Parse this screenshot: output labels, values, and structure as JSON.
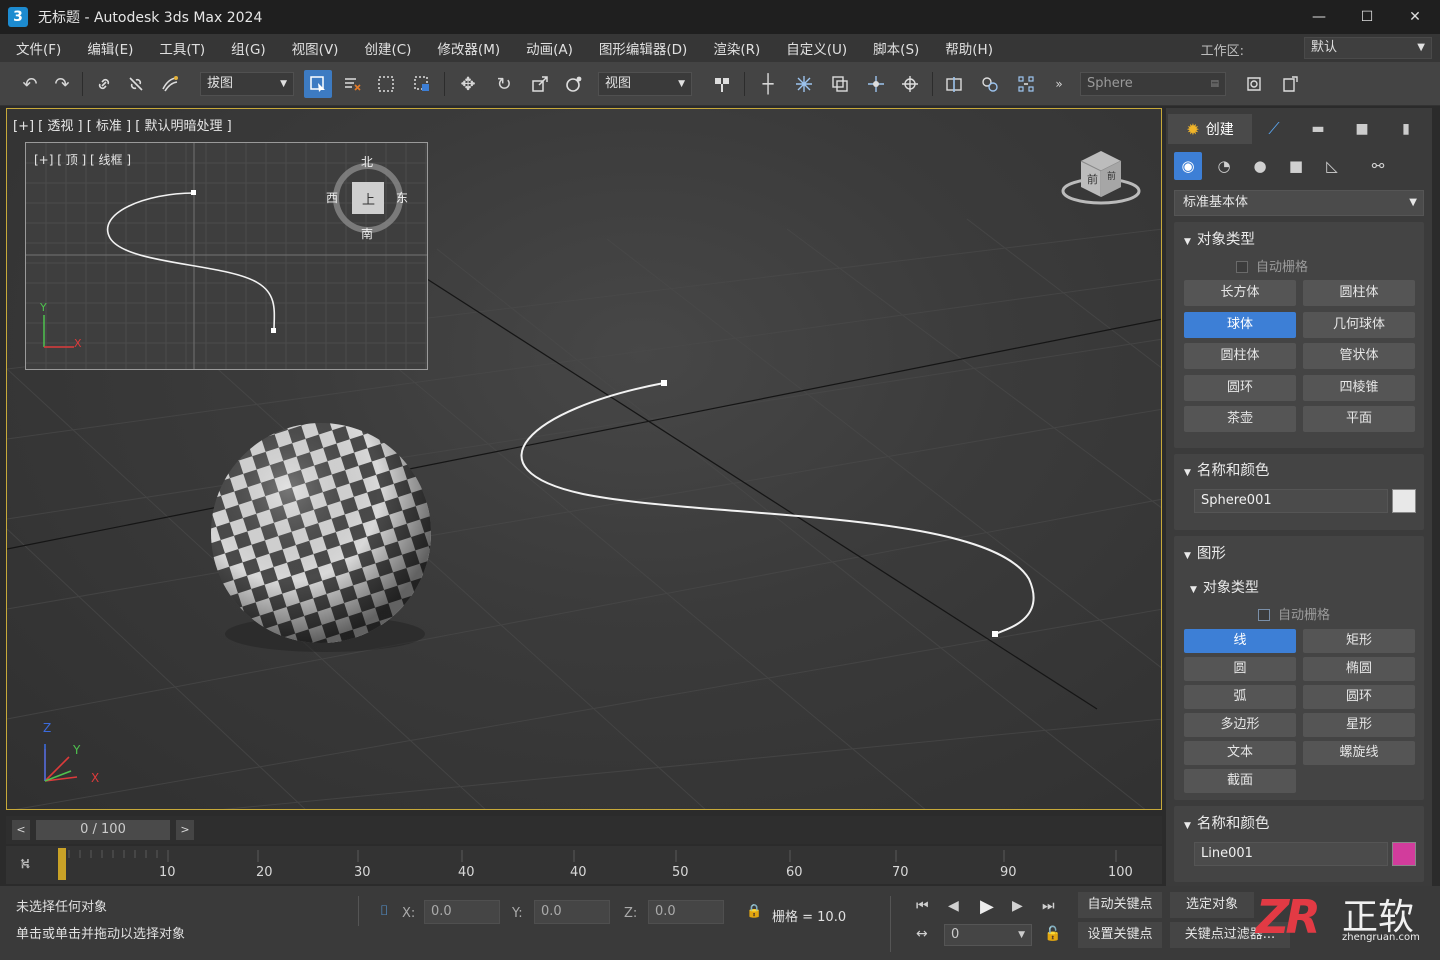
{
  "window": {
    "app_icon": "3",
    "title": "无标题 - Autodesk 3ds Max 2024",
    "minimize": "—",
    "maximize": "☐",
    "close": "✕"
  },
  "menu": [
    "文件(F)",
    "编辑(E)",
    "工具(T)",
    "组(G)",
    "视图(V)",
    "创建(C)",
    "修改器(M)",
    "动画(A)",
    "图形编辑器(D)",
    "渲染(R)",
    "自定义(U)",
    "脚本(S)",
    "帮助(H)"
  ],
  "workspace": {
    "label": "工作区:",
    "value": "默认"
  },
  "toolbar": {
    "selection_filter": "拔图",
    "reference_coord": "视图",
    "named_selection": "Sphere",
    "icons": [
      "undo-icon",
      "redo-icon",
      "link-icon",
      "unlink-icon",
      "bind-spacewarp-icon",
      "select-object-icon",
      "select-by-name-icon",
      "rect-selection-icon",
      "window-crossing-icon",
      "move-icon",
      "rotate-icon",
      "scale-icon",
      "place-icon",
      "pivot-icon",
      "snap-icon",
      "mirror-icon",
      "align-icon",
      "render-setup-icon",
      "render-icon"
    ]
  },
  "viewport": {
    "label": "[+] [ 透视 ] [ 标准 ] [ 默认明暗处理 ]",
    "inset_label": "[+] [ 顶 ] [ 线框 ]",
    "compass": {
      "north": "北",
      "south": "南",
      "west": "西",
      "east": "东",
      "center": "上"
    },
    "viewcube_front": "前",
    "viewcube_right": "前",
    "axis_x": "X",
    "axis_y": "Y",
    "axis_z": "Z"
  },
  "command_panel": {
    "tab_create": "创建",
    "category": "标准基本体",
    "rollout_object_type": "对象类型",
    "autogrid_label": "自动栅格",
    "primitives": [
      "长方体",
      "圆柱体",
      "球体",
      "几何球体",
      "圆柱体",
      "管状体",
      "圆环",
      "四棱锥",
      "茶壶",
      "平面"
    ],
    "primitive_selected": "球体",
    "rollout_name_color": "名称和颜色",
    "object_name": "Sphere001",
    "object_color": "#e8e8e8",
    "rollout_shapes": "图形",
    "sub_object_type": "对象类型",
    "shapes_autogrid": "自动栅格",
    "shapes": [
      "线",
      "矩形",
      "圆",
      "椭圆",
      "弧",
      "圆环",
      "多边形",
      "星形",
      "文本",
      "螺旋线",
      "截面"
    ],
    "shape_selected": "线",
    "rollout_name_color2": "名称和颜色",
    "object_name2": "Line001",
    "object_color2": "#d23c9c"
  },
  "timeline": {
    "frame_display": "0 / 100",
    "prev": "<",
    "next": ">",
    "ticks": [
      "10",
      "20",
      "30",
      "40",
      "40",
      "50",
      "60",
      "70",
      "90",
      "100"
    ]
  },
  "status": {
    "line1": "未选择任何对象",
    "line2": "单击或单击并拖动以选择对象",
    "x_label": "X:",
    "x_value": "0.0",
    "y_label": "Y:",
    "y_value": "0.0",
    "z_label": "Z:",
    "z_value": "0.0",
    "grid": "栅格 = 10.0",
    "auto_key": "自动关键点",
    "set_key": "设置关键点",
    "selected_object": "选定对象",
    "key_filters": "关键点过滤器...",
    "current_frame": "0"
  },
  "watermark": {
    "logo": "ZR",
    "name": "正软",
    "url": "zhengruan.com"
  },
  "colors": {
    "accent": "#3d7fd6",
    "viewport_border": "#c7a93a"
  }
}
